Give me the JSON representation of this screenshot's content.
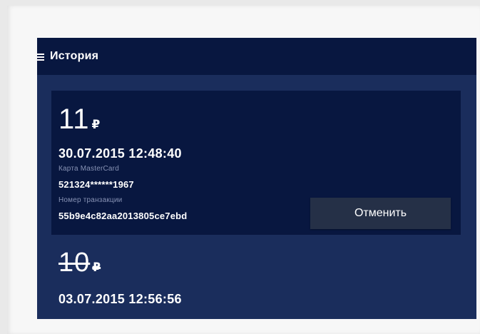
{
  "header": {
    "menu_icon": "hamburger-menu-icon",
    "title": "История"
  },
  "transactions": [
    {
      "amount": "11",
      "currency": "₽",
      "datetime": "30.07.2015 12:48:40",
      "card_label": "Карта MasterCard",
      "card_number": "521324******1967",
      "txn_label": "Номер транзакции",
      "txn_id": "55b9e4c82aa2013805ce7ebd",
      "cancel_label": "Отменить",
      "cancelled": false
    },
    {
      "amount": "10",
      "currency": "₽",
      "datetime": "03.07.2015 12:56:56",
      "cancelled": true
    }
  ],
  "colors": {
    "toolbar": "#081740",
    "list_background": "#1a2d5c",
    "card_background": "#081740",
    "button_background": "#253047",
    "label_gray": "#8893b5"
  }
}
